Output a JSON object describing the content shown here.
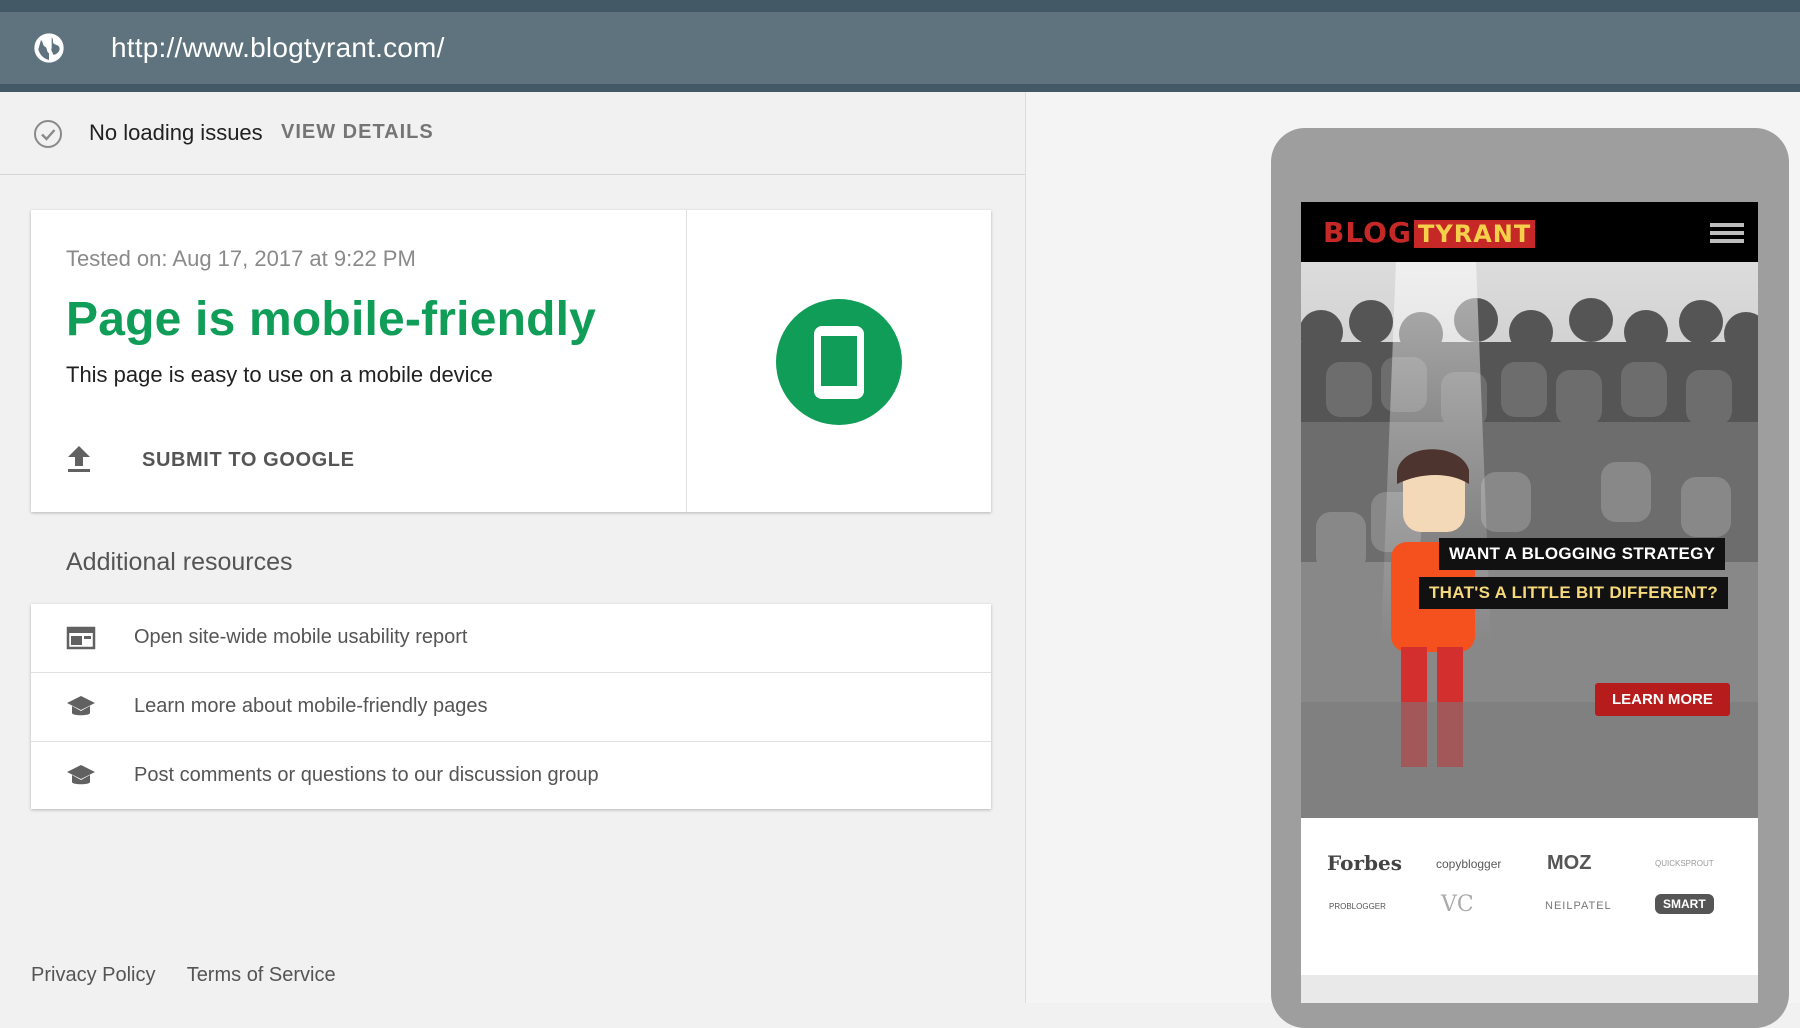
{
  "urlbar": {
    "url": "http://www.blogtyrant.com/",
    "icon": "globe-icon"
  },
  "status": {
    "text": "No loading issues",
    "details_label": "VIEW DETAILS",
    "icon": "check-circle-icon"
  },
  "result": {
    "tested_on": "Tested on: Aug 17, 2017 at 9:22 PM",
    "verdict": "Page is mobile-friendly",
    "description": "This page is easy to use on a mobile device",
    "submit_label": "SUBMIT TO GOOGLE",
    "accent_color": "#0f9d58"
  },
  "resources": {
    "title": "Additional resources",
    "items": [
      {
        "label": "Open site-wide mobile usability report",
        "icon": "web-layout-icon"
      },
      {
        "label": "Learn more about mobile-friendly pages",
        "icon": "school-icon"
      },
      {
        "label": "Post comments or questions to our discussion group",
        "icon": "school-icon"
      }
    ]
  },
  "footer": {
    "privacy": "Privacy Policy",
    "terms": "Terms of Service"
  },
  "preview": {
    "logo_part1": "BLOG",
    "logo_part2": "TYRANT",
    "headline_1": "WANT A BLOGGING STRATEGY",
    "headline_2": "THAT'S A LITTLE BIT DIFFERENT?",
    "cta": "LEARN MORE",
    "press_logos": [
      "Forbes",
      "copyblogger",
      "MOZ",
      "QUICKSPROUT",
      "PROBLOGGER",
      "VC",
      "NEILPATEL",
      "SMART"
    ]
  }
}
